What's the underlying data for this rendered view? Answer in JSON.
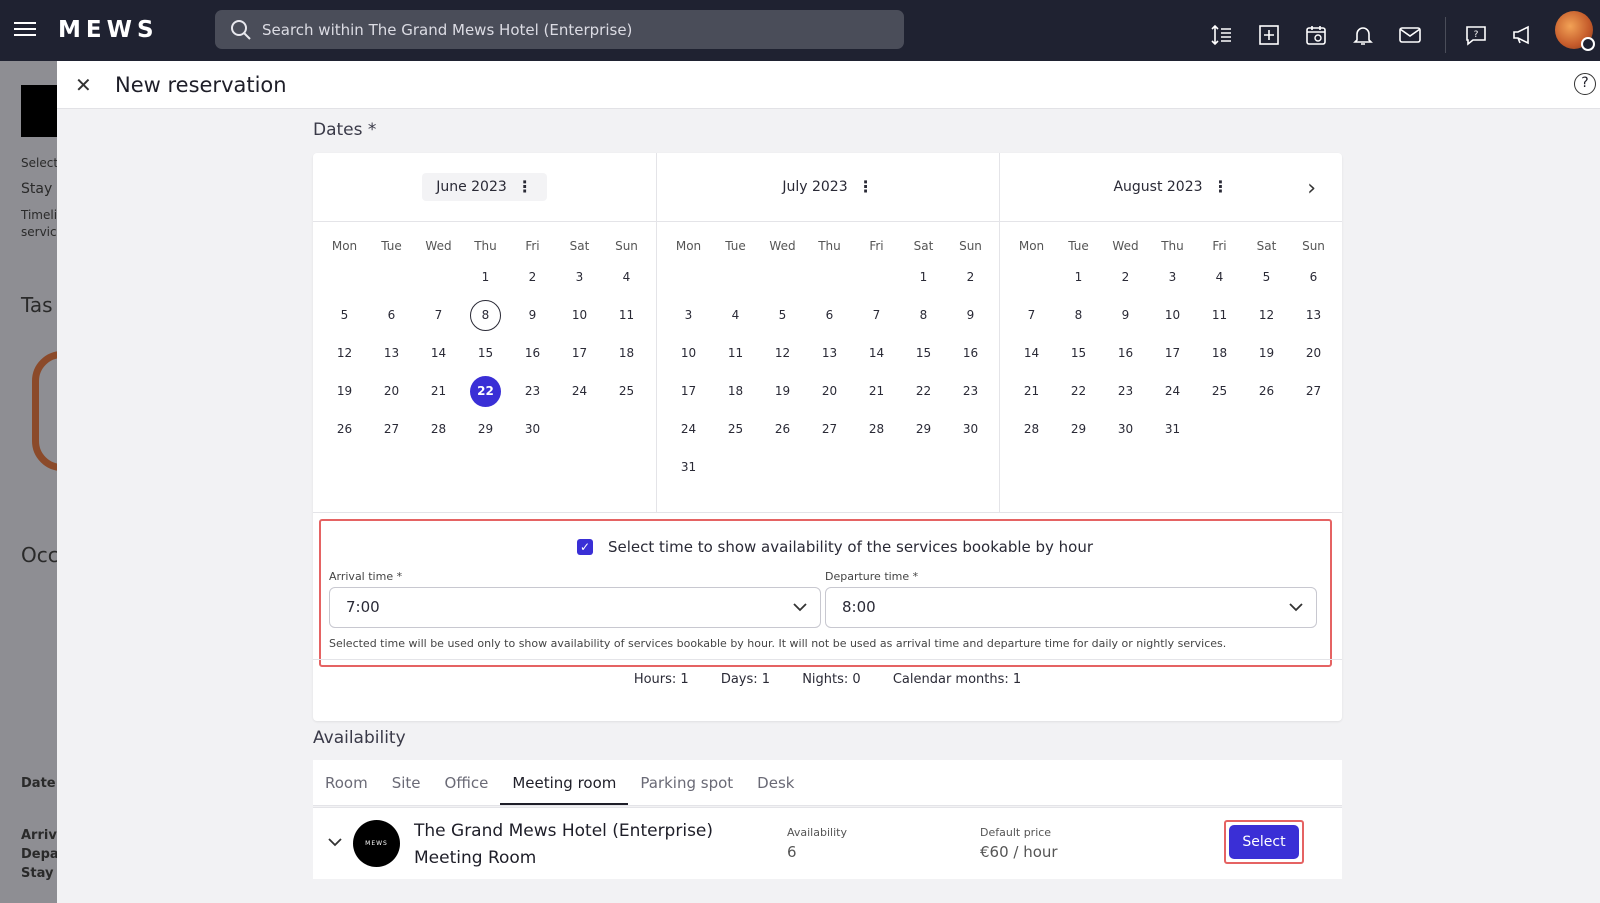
{
  "topbar": {
    "logo": "MEWS",
    "search_placeholder": "Search within The Grand Mews Hotel (Enterprise)",
    "icons": [
      "sort-icon",
      "add-icon",
      "calendar-sync-icon",
      "bell-icon",
      "mail-icon",
      "help-chat-icon",
      "megaphone-icon"
    ]
  },
  "background": {
    "select_label": "Select",
    "stay_label": "Stay",
    "timeline_label": "Timeli",
    "service_label": "servic",
    "tasks": "Tas",
    "occ": "Occ",
    "date": "Date",
    "arriv": "Arriva",
    "depart": "Depa",
    "stay": "Stay"
  },
  "panel": {
    "title": "New reservation",
    "help": "?"
  },
  "dates": {
    "label": "Dates *",
    "weekdays": [
      "Mon",
      "Tue",
      "Wed",
      "Thu",
      "Fri",
      "Sat",
      "Sun"
    ],
    "months": [
      {
        "title": "June 2023",
        "offset": 3,
        "days": 30,
        "today": 8,
        "selected": 22
      },
      {
        "title": "July 2023",
        "offset": 5,
        "days": 31
      },
      {
        "title": "August 2023",
        "offset": 1,
        "days": 31
      }
    ],
    "show_time_label": "Select time to show availability of the services bookable by hour",
    "arrival_label": "Arrival time *",
    "arrival_value": "7:00",
    "departure_label": "Departure time *",
    "departure_value": "8:00",
    "note": "Selected time will be used only to show availability of services bookable by hour. It will not be used as arrival time and departure time for daily or nightly services.",
    "stats": {
      "hours": "Hours: 1",
      "days": "Days: 1",
      "nights": "Nights: 0",
      "months": "Calendar months: 1"
    }
  },
  "availability": {
    "label": "Availability",
    "tabs": [
      "Room",
      "Site",
      "Office",
      "Meeting room",
      "Parking spot",
      "Desk"
    ],
    "active_tab": "Meeting room",
    "row": {
      "logo": "MEWS",
      "hotel": "The Grand Mews Hotel (Enterprise)",
      "service": "Meeting Room",
      "availability_label": "Availability",
      "availability_value": "6",
      "price_label": "Default price",
      "price_value": "€60 / hour",
      "select_label": "Select"
    }
  },
  "colors": {
    "accent": "#3a2fd6",
    "highlight": "#e56363",
    "topbar": "#1f2231"
  }
}
